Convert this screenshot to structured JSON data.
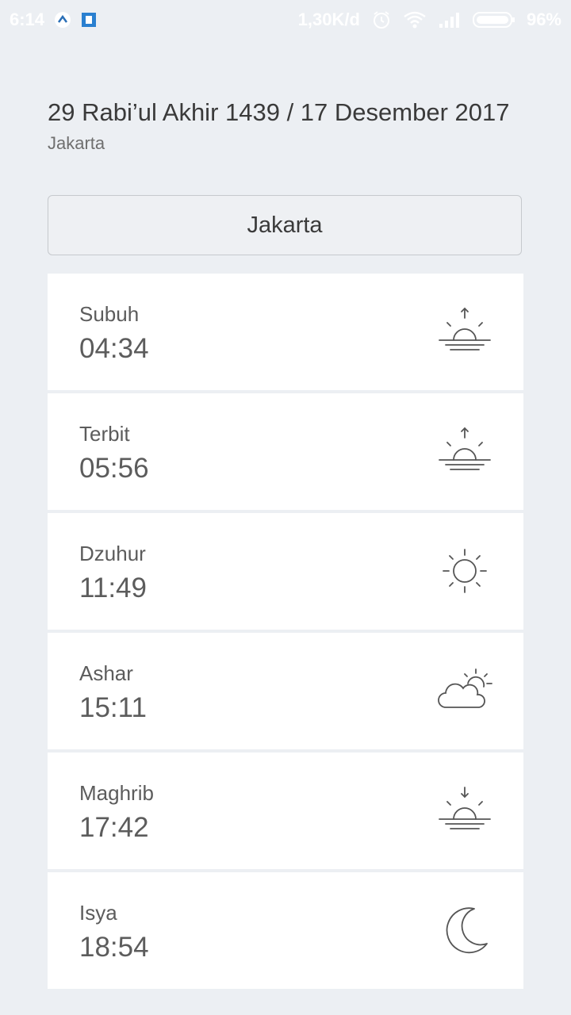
{
  "status_bar": {
    "time": "6:14",
    "network_speed": "1,30K/d",
    "battery": "96%",
    "icons": [
      "app-notification-icon",
      "app-square-icon",
      "alarm-icon",
      "wifi-icon",
      "signal-icon",
      "battery-icon"
    ]
  },
  "header": {
    "date": "29 Rabi’ul Akhir 1439 / 17 Desember 2017",
    "city": "Jakarta"
  },
  "city_selector": {
    "label": "Jakarta"
  },
  "prayers": [
    {
      "name": "Subuh",
      "time": "04:34",
      "icon": "sunrise-icon"
    },
    {
      "name": "Terbit",
      "time": "05:56",
      "icon": "sunrise-icon"
    },
    {
      "name": "Dzuhur",
      "time": "11:49",
      "icon": "sun-icon"
    },
    {
      "name": "Ashar",
      "time": "15:11",
      "icon": "cloud-sun-icon"
    },
    {
      "name": "Maghrib",
      "time": "17:42",
      "icon": "sunset-icon"
    },
    {
      "name": "Isya",
      "time": "18:54",
      "icon": "moon-icon"
    }
  ]
}
